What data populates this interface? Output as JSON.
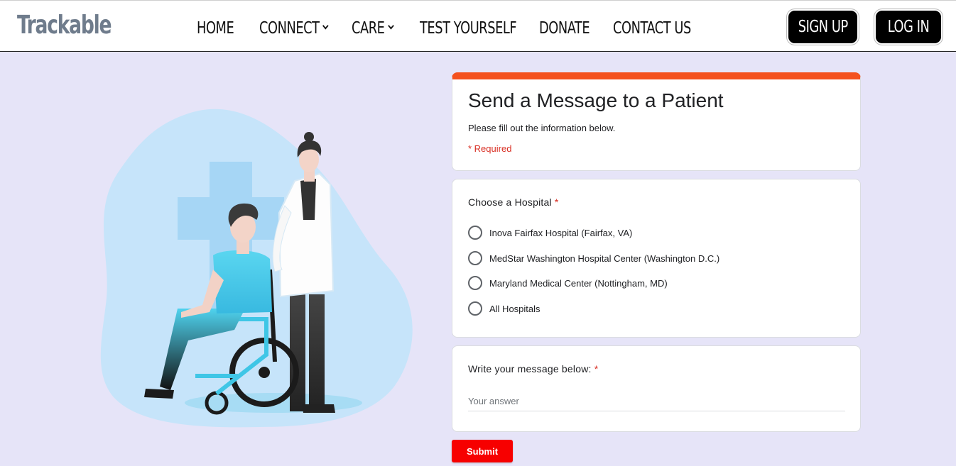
{
  "brand": "Trackable",
  "nav": {
    "home": "HOME",
    "connect": "CONNECT",
    "care": "CARE",
    "test": "TEST YOURSELF",
    "donate": "DONATE",
    "contact": "CONTACT US"
  },
  "auth": {
    "signup": "SIGN UP",
    "login": "LOG IN"
  },
  "form": {
    "title": "Send a Message to a Patient",
    "description": "Please fill out the information below.",
    "required_note": "* Required",
    "hospital_question": "Choose a Hospital",
    "required_star": "*",
    "hospital_options": [
      "Inova Fairfax Hospital (Fairfax, VA)",
      "MedStar Washington Hospital Center (Washington D.C.)",
      "Maryland Medical Center (Nottingham, MD)",
      "All Hospitals"
    ],
    "message_question": "Write your message below:",
    "answer_placeholder": "Your answer",
    "submit": "Submit"
  },
  "colors": {
    "accent": "#f4511e",
    "submit": "#f70000",
    "required": "#d93025",
    "page_background": "#e6e4f8"
  },
  "icons": {
    "dropdown": "chevron-down-icon",
    "radio": "radio-unchecked-icon"
  }
}
